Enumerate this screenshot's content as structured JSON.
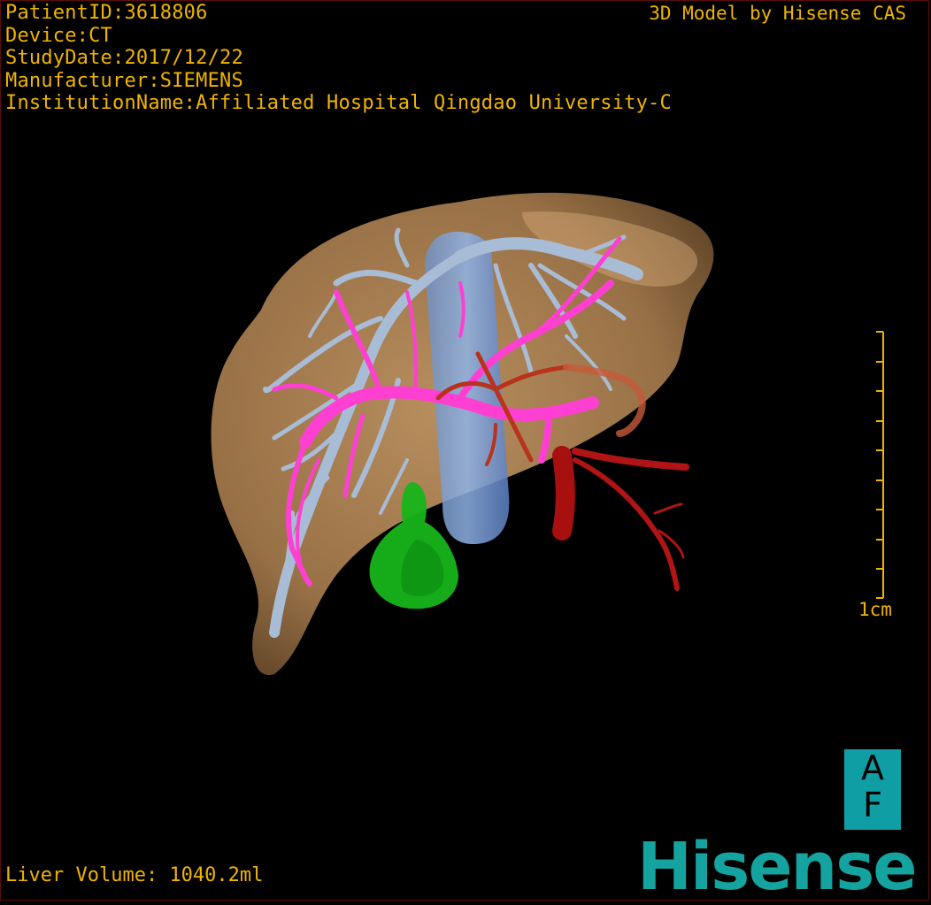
{
  "header": {
    "patient_id": "PatientID:3618806",
    "device": "Device:CT",
    "study_date": "StudyDate:2017/12/22",
    "manufacturer": "Manufacturer:SIEMENS",
    "institution": "InstitutionName:Affiliated Hospital Qingdao University-C"
  },
  "brand_tag": "3D Model by Hisense CAS",
  "scale_bar": {
    "label": "1cm"
  },
  "footer": {
    "liver_volume": "Liver Volume: 1040.2ml"
  },
  "orientation": {
    "top": "A",
    "bottom": "F"
  },
  "logo": "Hisense",
  "colors": {
    "overlay_text": "#f0b400",
    "liver": "#b58a5a",
    "hepatic_vein": "#a9bcd6",
    "portal_vein": "#ff3fd2",
    "artery": "#b01414",
    "gallbladder": "#16b41a",
    "ivc": "#5f8fd6",
    "brand": "#14a39e"
  }
}
